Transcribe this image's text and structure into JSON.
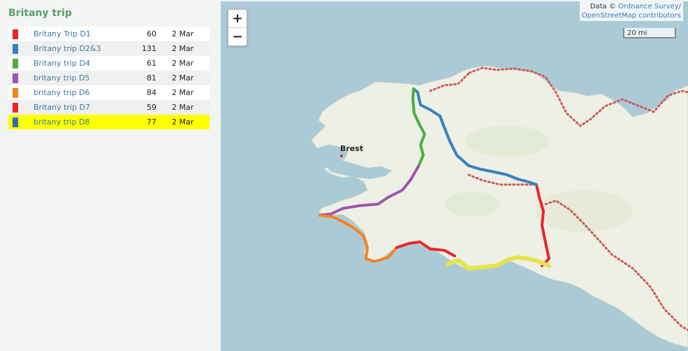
{
  "sidebar": {
    "title": "Britany trip",
    "routes": [
      {
        "name": "Britany Trip D1",
        "value": "60",
        "date": "2 Mar",
        "color": "#e8262b",
        "selected": false
      },
      {
        "name": "Britany trip D2&3",
        "value": "131",
        "date": "2 Mar",
        "color": "#3a7fc1",
        "selected": false
      },
      {
        "name": "Britany trip D4",
        "value": "61",
        "date": "2 Mar",
        "color": "#4fad3f",
        "selected": false
      },
      {
        "name": "britany trip D5",
        "value": "81",
        "date": "2 Mar",
        "color": "#9e55ad",
        "selected": false
      },
      {
        "name": "britany trip D6",
        "value": "84",
        "date": "2 Mar",
        "color": "#f58220",
        "selected": false
      },
      {
        "name": "Britany trip D7",
        "value": "59",
        "date": "2 Mar",
        "color": "#e8262b",
        "selected": false
      },
      {
        "name": "britany trip D8",
        "value": "77",
        "date": "2 Mar",
        "color": "#2f6db5",
        "selected": true
      }
    ]
  },
  "map": {
    "zoom_in": "+",
    "zoom_out": "−",
    "attribution_prefix": "Data © ",
    "attribution_link1": "Ordnance Survey/",
    "attribution_link2": "OpenStreetMap contributors",
    "scale_label": "20 mi",
    "place_label": "Brest",
    "colors": {
      "sea": "#aacbd6",
      "land": "#eef0e6",
      "highlight": "#ffff00"
    }
  }
}
